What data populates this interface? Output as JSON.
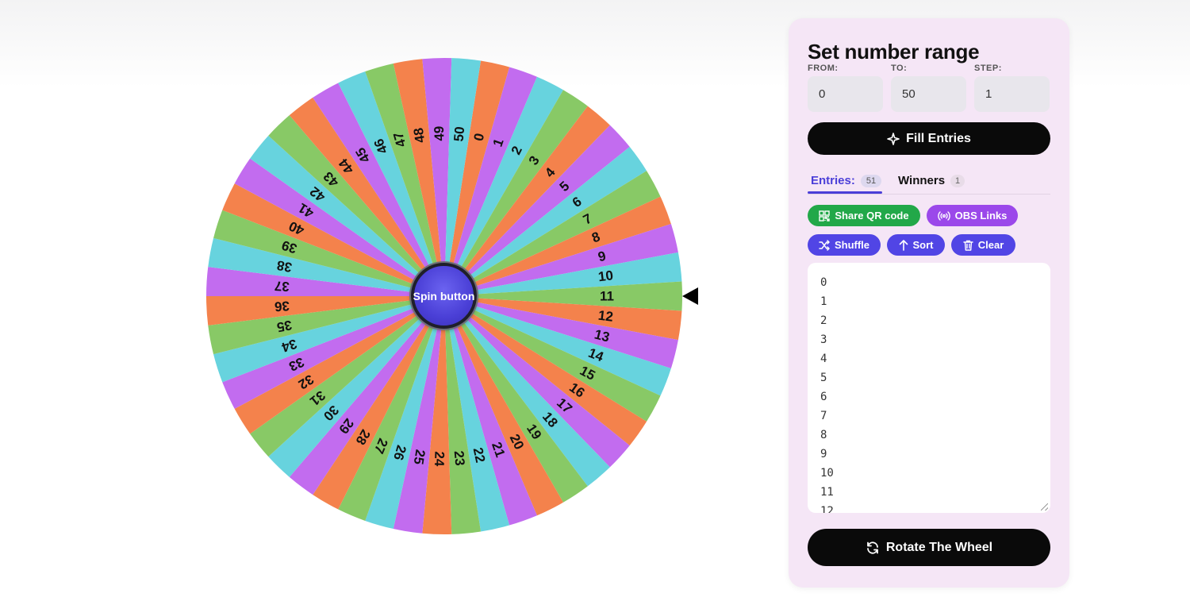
{
  "wheel": {
    "entries": [
      "0",
      "1",
      "2",
      "3",
      "4",
      "5",
      "6",
      "7",
      "8",
      "9",
      "10",
      "11",
      "12",
      "13",
      "14",
      "15",
      "16",
      "17",
      "18",
      "19",
      "20",
      "21",
      "22",
      "23",
      "24",
      "25",
      "26",
      "27",
      "28",
      "29",
      "30",
      "31",
      "32",
      "33",
      "34",
      "35",
      "36",
      "37",
      "38",
      "39",
      "40",
      "41",
      "42",
      "43",
      "44",
      "45",
      "46",
      "47",
      "48",
      "49",
      "50"
    ],
    "segment_colors": [
      "#f4824c",
      "#c26cef",
      "#67d3de",
      "#88c966"
    ],
    "spin_label": "Spin button",
    "pointer_icon": "triangle-pointer-icon"
  },
  "panel": {
    "title": "Set number range",
    "from_label": "FROM:",
    "to_label": "TO:",
    "step_label": "STEP:",
    "from_value": "0",
    "to_value": "50",
    "step_value": "1",
    "fill_label": "Fill Entries",
    "tabs": {
      "entries_label": "Entries:",
      "entries_count": "51",
      "winners_label": "Winners",
      "winners_count": "1"
    },
    "actions": {
      "share_qr": "Share QR code",
      "obs_links": "OBS Links",
      "shuffle": "Shuffle",
      "sort": "Sort",
      "clear": "Clear"
    },
    "entries_text": [
      "0",
      "1",
      "2",
      "3",
      "4",
      "5",
      "6",
      "7",
      "8",
      "9",
      "10",
      "11",
      "12"
    ],
    "rotate_label": "Rotate The Wheel"
  },
  "colors": {
    "accent": "#5145e5",
    "green_button": "#22a849",
    "purple_button": "#9b48ea",
    "panel_bg": "#f5e6f6"
  }
}
